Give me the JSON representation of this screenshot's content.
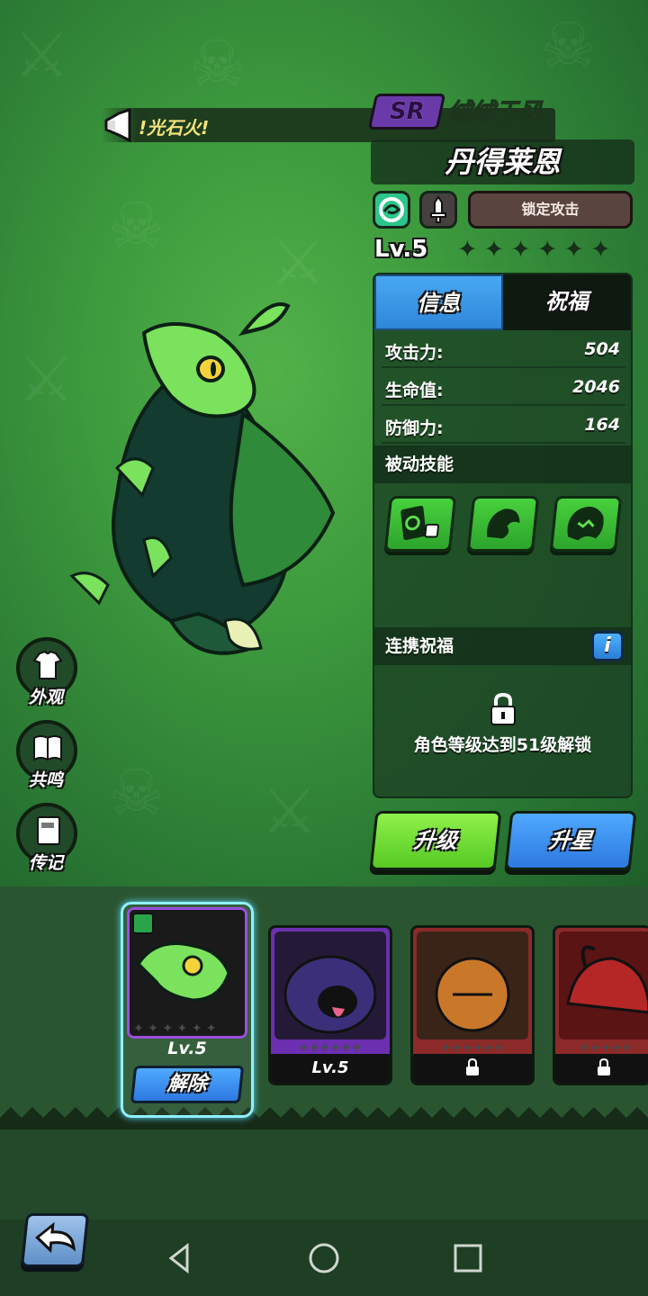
{
  "ticker": {
    "text": "!光石火!"
  },
  "hero": {
    "rarity": "SR",
    "subtitle": "绒绒于风",
    "name": "丹得莱恩",
    "lock_attack_label": "锁定攻击",
    "level": "Lv.5",
    "stars_filled": 0,
    "stars_total": 6
  },
  "panel": {
    "tabs": [
      {
        "label": "信息",
        "active": true
      },
      {
        "label": "祝福",
        "active": false
      }
    ],
    "stats": [
      {
        "label": "攻击力:",
        "value": "504"
      },
      {
        "label": "生命值:",
        "value": "2046"
      },
      {
        "label": "防御力:",
        "value": "164"
      }
    ],
    "passive_title": "被动技能",
    "passive_skills": [
      "card-skill-icon",
      "beast-skill-icon",
      "ghost-skill-icon"
    ],
    "bond_title": "连携祝福",
    "info_label": "i",
    "unlock_text": "角色等级达到51级解锁"
  },
  "actions": {
    "upgrade": "升级",
    "star_up": "升星"
  },
  "side_menu": [
    {
      "label": "外观",
      "icon": "shirt-icon"
    },
    {
      "label": "共鸣",
      "icon": "book-icon"
    },
    {
      "label": "传记",
      "icon": "journal-icon"
    }
  ],
  "roster": {
    "selected": {
      "level": "Lv.5",
      "remove_label": "解除"
    },
    "cards": [
      {
        "level": "Lv.5",
        "locked": false
      },
      {
        "level": "",
        "locked": true
      },
      {
        "level": "",
        "locked": true
      }
    ]
  },
  "colors": {
    "bg_green": "#3d9a3d",
    "accent_blue": "#2f86d9",
    "accent_lime": "#8ef14a",
    "rarity_purple": "#6a3aa8"
  }
}
